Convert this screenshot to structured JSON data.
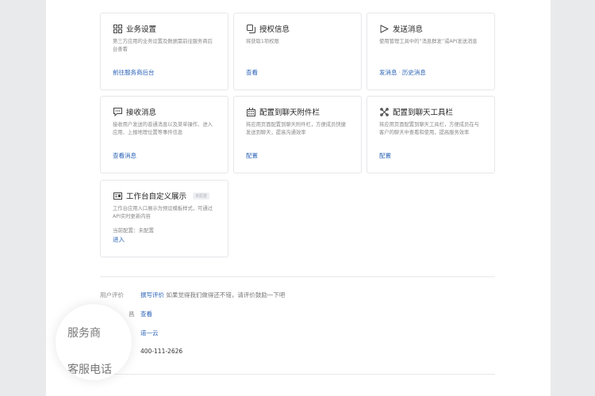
{
  "cards": [
    {
      "title": "业务设置",
      "desc": "第三方应用的业务设置及数据需前往服务商后台查看",
      "link": "前往服务商后台",
      "icon": "grid-icon"
    },
    {
      "title": "授权信息",
      "desc": "将获取1项权限",
      "link": "查看",
      "icon": "copy-icon"
    },
    {
      "title": "发送消息",
      "desc": "使用管理工具中的“消息群发”或API发送消息",
      "link_a": "发消息",
      "link_sep": "·",
      "link_b": "历史消息",
      "icon": "send-icon"
    },
    {
      "title": "接收消息",
      "desc": "接收用户发送的普通消息以及菜单操作、进入应用、上报地理位置等事件信息",
      "link": "查看消息",
      "icon": "chat-icon"
    },
    {
      "title": "配置到聊天附件栏",
      "desc": "将应用页面配置到聊天附件栏，方便成员快捷发送到聊天，提高沟通效率",
      "link": "配置",
      "icon": "attachment-grid-icon"
    },
    {
      "title": "配置到聊天工具栏",
      "desc": "将应用页面配置到聊天工具栏，方便成员在与客户的聊天中查看和使用，提高服务效率",
      "link": "配置",
      "icon": "tools-icon"
    },
    {
      "title": "工作台自定义展示",
      "tag": "未配置",
      "desc": "工作台应用入口展示为预设模板样式，可通过API实时更新内容",
      "status": "当前配置：未配置",
      "link": "进入",
      "icon": "display-card-icon"
    }
  ],
  "info": {
    "rating_label": "用户评价",
    "rating_link": "撰写评价",
    "rating_text": "如果觉得我们做得还不错，请评价鼓励一下吧",
    "row2_label_fragment": "昌",
    "row2_value": "查看",
    "provider_value": "道一云",
    "phone_value": "400-111-2626"
  },
  "magnifier": {
    "provider_label": "服务商",
    "phone_label": "客服电话"
  },
  "colors": {
    "link": "#2b63b7",
    "background": "#e9eaec",
    "panel": "#ffffff"
  }
}
